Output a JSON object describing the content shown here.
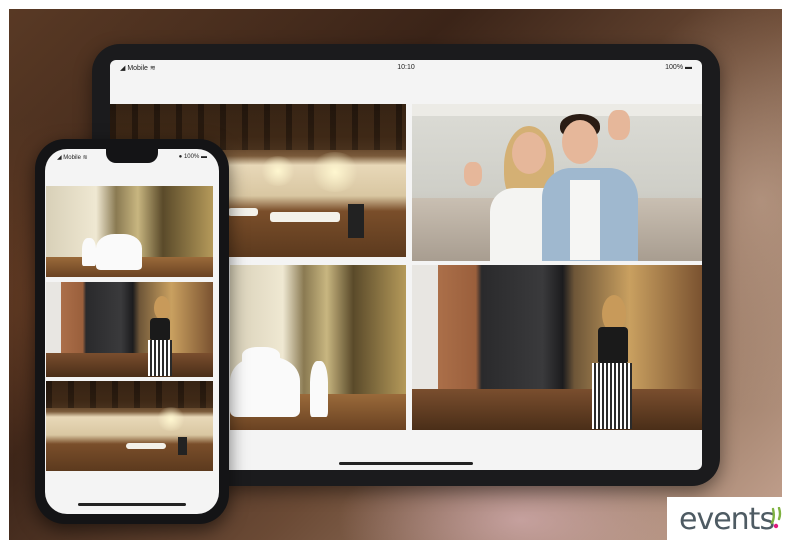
{
  "tablet": {
    "status": {
      "carrier": "Mobile",
      "time": "10:10",
      "battery": "100%"
    },
    "photos": [
      "banquet-hall",
      "couple-waving",
      "corridor-tables",
      "woman-at-door"
    ]
  },
  "phone": {
    "status": {
      "carrier": "Mobile",
      "battery": "100%"
    },
    "photos": [
      "corridor-tables",
      "woman-at-door",
      "banquet-hall"
    ]
  },
  "logo": {
    "text": "events"
  },
  "colors": {
    "device": "#1b1b1d",
    "screen": "#f4f4f4",
    "logo_text": "#4e5b63",
    "logo_green": "#7fb241",
    "logo_pink": "#e0197d"
  }
}
